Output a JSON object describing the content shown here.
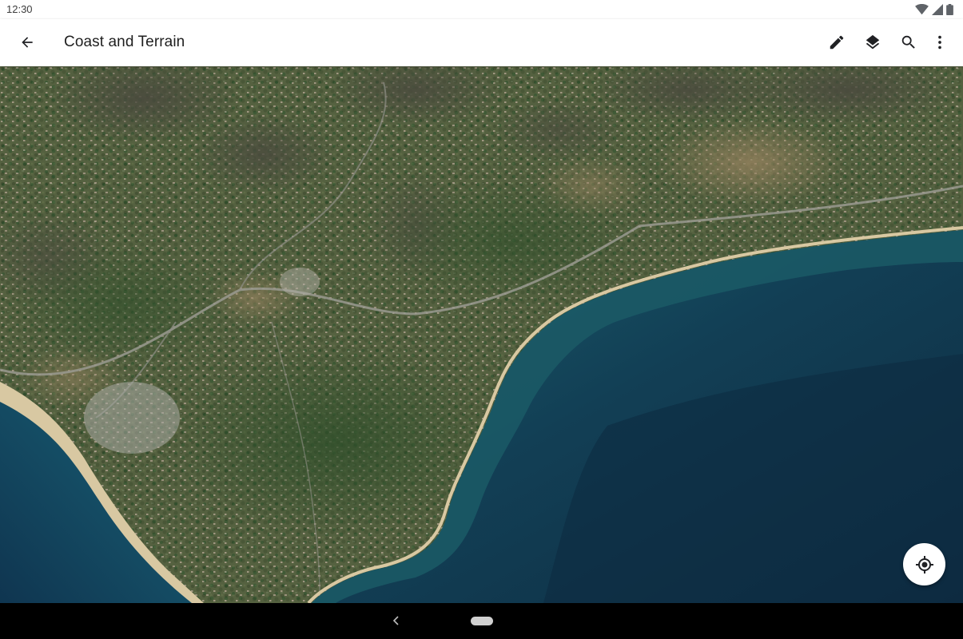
{
  "status_bar": {
    "time": "12:30",
    "icons": [
      "wifi-icon",
      "cell-signal-icon",
      "battery-icon"
    ]
  },
  "app_bar": {
    "title": "Coast and Terrain",
    "navigation_icon": "arrow-back-icon",
    "actions": [
      "edit-icon",
      "layers-icon",
      "search-icon",
      "more-vert-icon"
    ]
  },
  "map": {
    "style": "satellite",
    "locate_icon": "my-location-icon"
  },
  "nav_bar": {
    "icons": [
      "nav-back-icon",
      "nav-home-pill"
    ]
  },
  "colors": {
    "app_bar_bg": "#ffffff",
    "title_text": "#1f1f1f",
    "icon": "#202124",
    "ocean_deep": "#0f2f45",
    "ocean_shallow": "#1a5a68",
    "land_green": "#3b5a35",
    "land_tan": "#8c7a5a",
    "beach": "#d8c8a2"
  }
}
